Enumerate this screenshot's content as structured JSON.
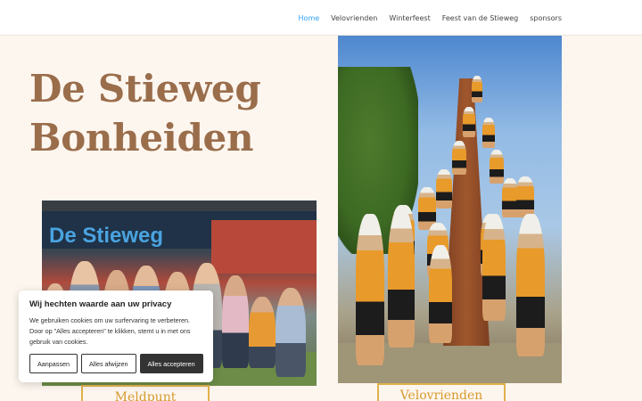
{
  "nav": {
    "items": [
      {
        "label": "Home",
        "active": true
      },
      {
        "label": "Velovrienden",
        "active": false
      },
      {
        "label": "Winterfeest",
        "active": false
      },
      {
        "label": "Feest van de Stieweg",
        "active": false
      },
      {
        "label": "sponsors",
        "active": false
      }
    ]
  },
  "hero": {
    "title_line1": "De Stieweg",
    "title_line2": "Bonheiden"
  },
  "photos": {
    "left_banner_text": "De Stieweg"
  },
  "buttons": {
    "left_label": "Meldpunt",
    "right_label": "Velovrienden"
  },
  "cookie": {
    "title": "Wij hechten waarde aan uw privacy",
    "body": "We gebruiken cookies om uw surfervaring te verbeteren. Door op \"Alles accepteren\" te klikken, stemt u in met ons gebruik van cookies.",
    "customize_label": "Aanpassen",
    "reject_label": "Alles afwijzen",
    "accept_label": "Alles accepteren"
  },
  "colors": {
    "accent_title": "#9a6d4b",
    "nav_active": "#2ea3f2",
    "button_border": "#e0b14a",
    "page_background": "#fdf6ef"
  }
}
